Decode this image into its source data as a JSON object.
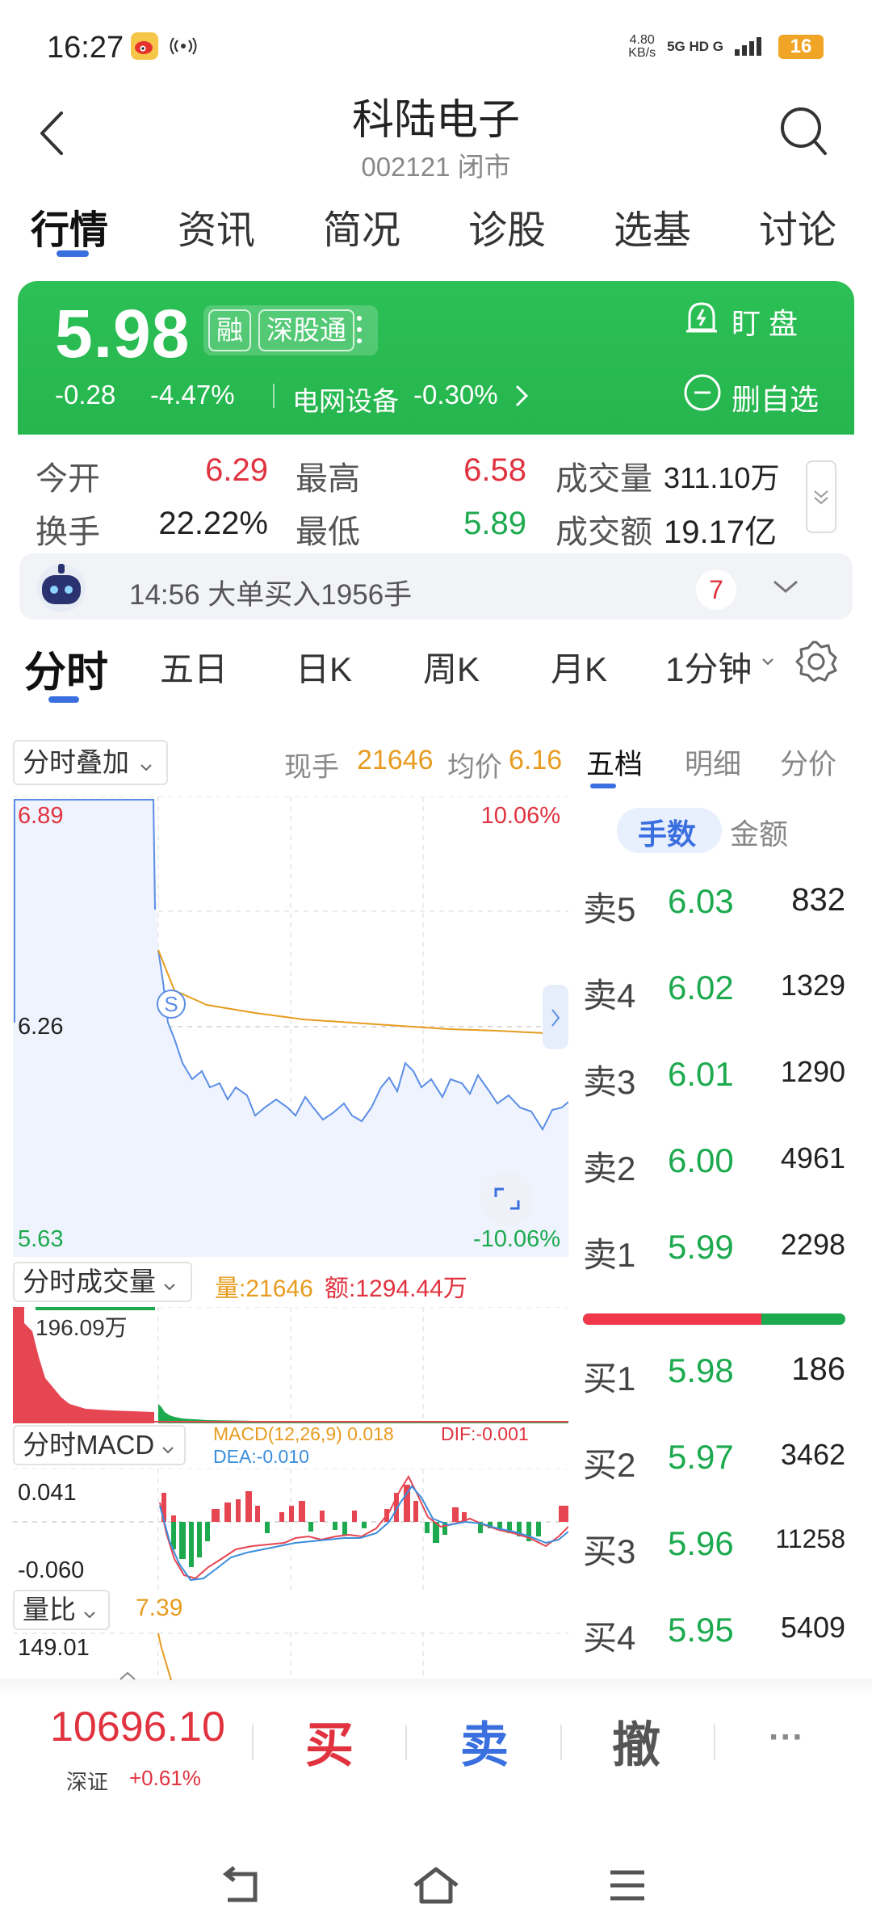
{
  "status_bar": {
    "time": "16:27",
    "net_speed": "4.80",
    "net_unit": "KB/s",
    "net_type": "5G HD G",
    "battery": "16"
  },
  "header": {
    "title": "科陆电子",
    "subtitle": "002121 闭市"
  },
  "tabs": [
    "行情",
    "资讯",
    "简况",
    "诊股",
    "选基",
    "讨论"
  ],
  "quote": {
    "price": "5.98",
    "badge_margin": "融",
    "badge_connect": "深股通",
    "change": "-0.28",
    "change_pct": "-4.47%",
    "sector": "电网设备",
    "sector_pct": "-0.30%",
    "watch_label": "盯 盘",
    "remove_label": "删自选"
  },
  "stats": [
    {
      "label": "今开",
      "value": "6.29",
      "color": "#e0333f"
    },
    {
      "label": "最高",
      "value": "6.58",
      "color": "#e0333f"
    },
    {
      "label": "成交量",
      "value": "311.10万",
      "color": "#222222"
    },
    {
      "label": "换手",
      "value": "22.22%",
      "color": "#222222"
    },
    {
      "label": "最低",
      "value": "5.89",
      "color": "#1daa4f"
    },
    {
      "label": "成交额",
      "value": "19.17亿",
      "color": "#222222"
    }
  ],
  "alert": {
    "text": "14:56 大单买入1956手",
    "count": "7"
  },
  "chart_tabs": [
    "分时",
    "五日",
    "日K",
    "周K",
    "月K",
    "1分钟"
  ],
  "intraday": {
    "overlay_label": "分时叠加",
    "current_hand_label": "现手",
    "current_hand": "21646",
    "avg_label": "均价",
    "avg_price": "6.16",
    "y_top": "6.89",
    "y_mid": "6.26",
    "y_bot": "5.63",
    "pct_top": "10.06%",
    "pct_bot": "-10.06%",
    "s_marker": "S"
  },
  "volume_panel": {
    "label": "分时成交量",
    "vol_text": "量:21646",
    "amt_text": "额:1294.44万",
    "max_label": "196.09万"
  },
  "macd_panel": {
    "label": "分时MACD",
    "macd_text": "MACD(12,26,9)  0.018",
    "dif_text": "DIF:-0.001",
    "dea_text": "DEA:-0.010",
    "y_top": "0.041",
    "y_bot": "-0.060"
  },
  "ratio_panel": {
    "label": "量比",
    "value": "7.39",
    "y_top": "149.01"
  },
  "orderbook": {
    "tabs": [
      "五档",
      "明细",
      "分价"
    ],
    "toggle": [
      "手数",
      "金额"
    ],
    "asks": [
      {
        "label": "卖5",
        "price": "6.03",
        "vol": "832"
      },
      {
        "label": "卖4",
        "price": "6.02",
        "vol": "1329"
      },
      {
        "label": "卖3",
        "price": "6.01",
        "vol": "1290"
      },
      {
        "label": "卖2",
        "price": "6.00",
        "vol": "4961"
      },
      {
        "label": "卖1",
        "price": "5.99",
        "vol": "2298"
      }
    ],
    "buy_ratio": 0.68,
    "bids": [
      {
        "label": "买1",
        "price": "5.98",
        "vol": "186"
      },
      {
        "label": "买2",
        "price": "5.97",
        "vol": "3462"
      },
      {
        "label": "买3",
        "price": "5.96",
        "vol": "11258"
      },
      {
        "label": "买4",
        "price": "5.95",
        "vol": "5409"
      }
    ]
  },
  "bottom_bar": {
    "index_value": "10696.10",
    "index_name": "深证",
    "index_change": "+0.61%",
    "buy": "买",
    "sell": "卖",
    "cancel": "撤",
    "more": "···"
  },
  "colors": {
    "up": "#e0333f",
    "down": "#1daa4f",
    "accent": "#3a6fe0",
    "avg_line": "#e79c1f"
  }
}
